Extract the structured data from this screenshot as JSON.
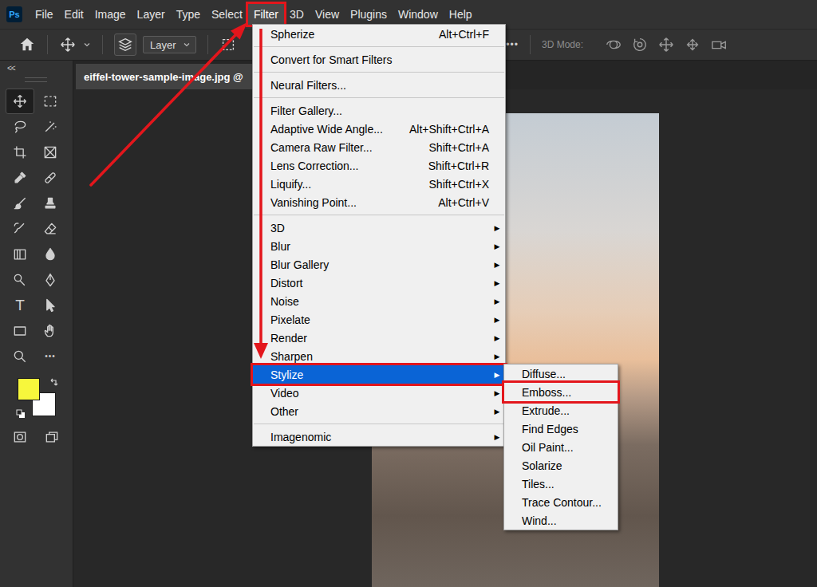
{
  "app": {
    "logo": "Ps"
  },
  "menu_bar": [
    {
      "label": "File",
      "selected": false,
      "annotated": false
    },
    {
      "label": "Edit",
      "selected": false,
      "annotated": false
    },
    {
      "label": "Image",
      "selected": false,
      "annotated": false
    },
    {
      "label": "Layer",
      "selected": false,
      "annotated": false
    },
    {
      "label": "Type",
      "selected": false,
      "annotated": false
    },
    {
      "label": "Select",
      "selected": false,
      "annotated": false
    },
    {
      "label": "Filter",
      "selected": true,
      "annotated": true
    },
    {
      "label": "3D",
      "selected": false,
      "annotated": false
    },
    {
      "label": "View",
      "selected": false,
      "annotated": false
    },
    {
      "label": "Plugins",
      "selected": false,
      "annotated": false
    },
    {
      "label": "Window",
      "selected": false,
      "annotated": false
    },
    {
      "label": "Help",
      "selected": false,
      "annotated": false
    }
  ],
  "options_bar": {
    "layer_dropdown": "Layer",
    "more": "•••",
    "mode_label": "3D Mode:"
  },
  "toolbar": {
    "collapse": "<<",
    "tools": [
      {
        "selected": true
      },
      {
        "selected": false
      },
      {
        "selected": false
      },
      {
        "selected": false
      },
      {
        "selected": false
      },
      {
        "selected": false
      },
      {
        "selected": false
      },
      {
        "selected": false
      },
      {
        "selected": false
      },
      {
        "selected": false
      },
      {
        "selected": false
      },
      {
        "selected": false
      },
      {
        "selected": false
      },
      {
        "selected": false
      },
      {
        "selected": false
      },
      {
        "selected": false
      },
      {
        "selected": false,
        "glyph": "T"
      },
      {
        "selected": false
      },
      {
        "selected": false
      },
      {
        "selected": false
      },
      {
        "selected": false
      },
      {
        "selected": false,
        "glyph": "•••"
      }
    ],
    "foreground_color": "#f7f73c",
    "background_color": "#ffffff"
  },
  "document_tab": {
    "title": "eiffel-tower-sample-image.jpg @",
    "selected": true
  },
  "filter_menu": {
    "submenu_arrow": "▶",
    "items": [
      {
        "kind": "item",
        "label": "Spherize",
        "shortcut": "Alt+Ctrl+F",
        "submenu": false,
        "selected": false,
        "annotated": false
      },
      {
        "kind": "separator",
        "selected": false
      },
      {
        "kind": "item",
        "label": "Convert for Smart Filters",
        "submenu": false,
        "selected": false,
        "annotated": false
      },
      {
        "kind": "separator",
        "selected": false
      },
      {
        "kind": "item",
        "label": "Neural Filters...",
        "submenu": false,
        "selected": false,
        "annotated": false
      },
      {
        "kind": "separator",
        "selected": false
      },
      {
        "kind": "item",
        "label": "Filter Gallery...",
        "submenu": false,
        "selected": false,
        "annotated": false
      },
      {
        "kind": "item",
        "label": "Adaptive Wide Angle...",
        "shortcut": "Alt+Shift+Ctrl+A",
        "submenu": false,
        "selected": false,
        "annotated": false
      },
      {
        "kind": "item",
        "label": "Camera Raw Filter...",
        "shortcut": "Shift+Ctrl+A",
        "submenu": false,
        "selected": false,
        "annotated": false
      },
      {
        "kind": "item",
        "label": "Lens Correction...",
        "shortcut": "Shift+Ctrl+R",
        "submenu": false,
        "selected": false,
        "annotated": false
      },
      {
        "kind": "item",
        "label": "Liquify...",
        "shortcut": "Shift+Ctrl+X",
        "submenu": false,
        "selected": false,
        "annotated": false
      },
      {
        "kind": "item",
        "label": "Vanishing Point...",
        "shortcut": "Alt+Ctrl+V",
        "submenu": false,
        "selected": false,
        "annotated": false
      },
      {
        "kind": "separator",
        "selected": false
      },
      {
        "kind": "item",
        "label": "3D",
        "submenu": true,
        "selected": false,
        "annotated": false
      },
      {
        "kind": "item",
        "label": "Blur",
        "submenu": true,
        "selected": false,
        "annotated": false
      },
      {
        "kind": "item",
        "label": "Blur Gallery",
        "submenu": true,
        "selected": false,
        "annotated": false
      },
      {
        "kind": "item",
        "label": "Distort",
        "submenu": true,
        "selected": false,
        "annotated": false
      },
      {
        "kind": "item",
        "label": "Noise",
        "submenu": true,
        "selected": false,
        "annotated": false
      },
      {
        "kind": "item",
        "label": "Pixelate",
        "submenu": true,
        "selected": false,
        "annotated": false
      },
      {
        "kind": "item",
        "label": "Render",
        "submenu": true,
        "selected": false,
        "annotated": false
      },
      {
        "kind": "item",
        "label": "Sharpen",
        "submenu": true,
        "selected": false,
        "annotated": false
      },
      {
        "kind": "item",
        "label": "Stylize",
        "submenu": true,
        "selected": true,
        "annotated": true
      },
      {
        "kind": "item",
        "label": "Video",
        "submenu": true,
        "selected": false,
        "annotated": false
      },
      {
        "kind": "item",
        "label": "Other",
        "submenu": true,
        "selected": false,
        "annotated": false
      },
      {
        "kind": "separator",
        "selected": false
      },
      {
        "kind": "item",
        "label": "Imagenomic",
        "submenu": true,
        "selected": false,
        "annotated": false
      }
    ]
  },
  "stylize_submenu": {
    "items": [
      {
        "label": "Diffuse...",
        "selected": false,
        "annotated": false
      },
      {
        "label": "Emboss...",
        "selected": false,
        "annotated": true
      },
      {
        "label": "Extrude...",
        "selected": false,
        "annotated": false
      },
      {
        "label": "Find Edges",
        "selected": false,
        "annotated": false
      },
      {
        "label": "Oil Paint...",
        "selected": false,
        "annotated": false
      },
      {
        "label": "Solarize",
        "selected": false,
        "annotated": false
      },
      {
        "label": "Tiles...",
        "selected": false,
        "annotated": false
      },
      {
        "label": "Trace Contour...",
        "selected": false,
        "annotated": false
      },
      {
        "label": "Wind...",
        "selected": false,
        "annotated": false
      }
    ]
  }
}
